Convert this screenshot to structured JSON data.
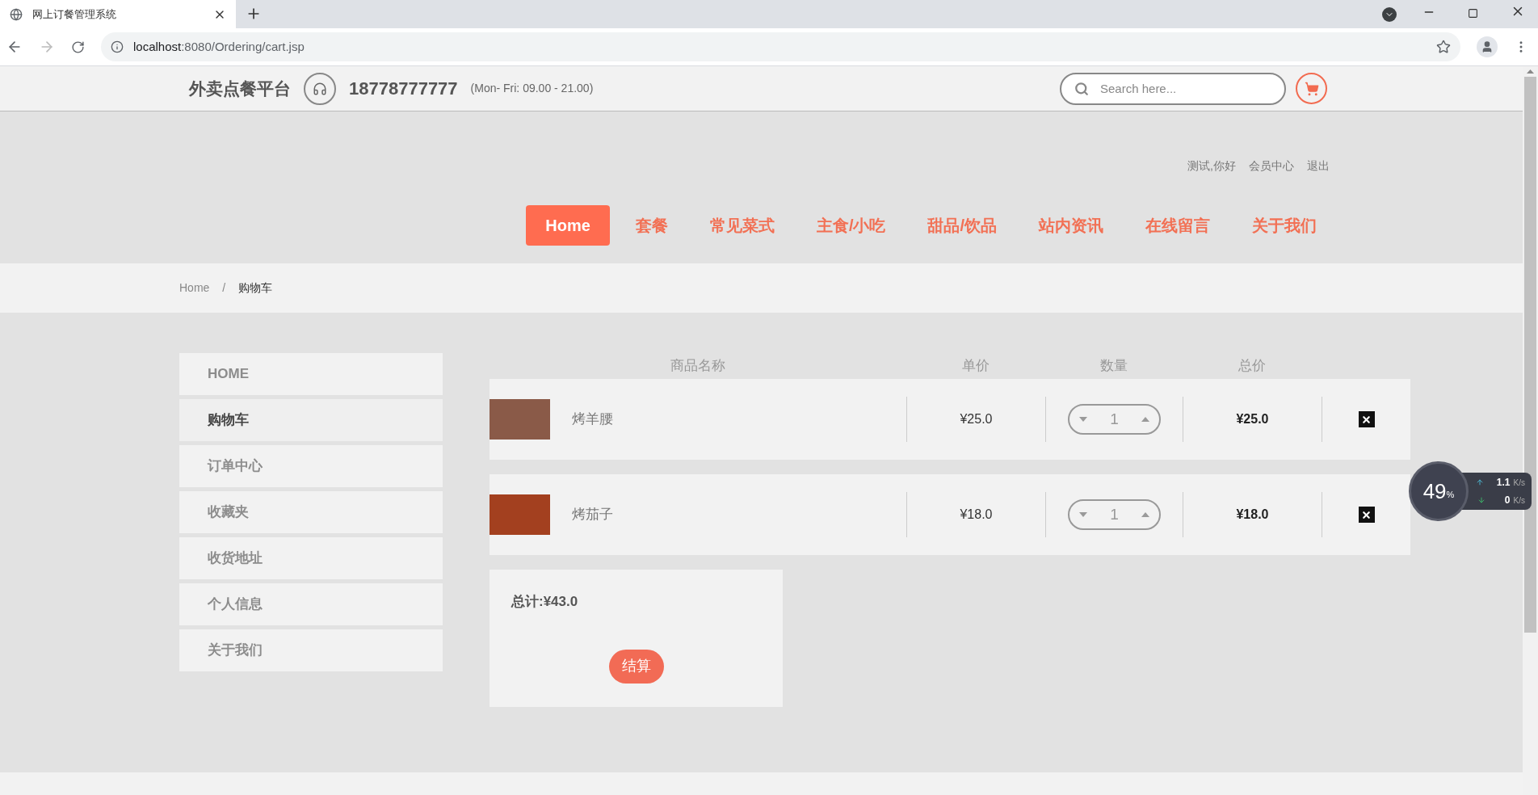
{
  "browser": {
    "tab_title": "网上订餐管理系统",
    "url_host": "localhost",
    "url_path": ":8080/Ordering/cart.jsp"
  },
  "header": {
    "logo": "外卖点餐平台",
    "phone": "18778777777",
    "hours": "(Mon- Fri: 09.00 - 21.00)",
    "search": {
      "placeholder": "Search here..."
    }
  },
  "user_links": [
    "测试,你好",
    "会员中心",
    "退出"
  ],
  "nav": [
    {
      "label": "Home",
      "selected": true
    },
    {
      "label": "套餐",
      "selected": false
    },
    {
      "label": "常见菜式",
      "selected": false
    },
    {
      "label": "主食/小吃",
      "selected": false
    },
    {
      "label": "甜品/饮品",
      "selected": false
    },
    {
      "label": "站内资讯",
      "selected": false
    },
    {
      "label": "在线留言",
      "selected": false
    },
    {
      "label": "关于我们",
      "selected": false
    }
  ],
  "breadcrumb": {
    "items": [
      "Home",
      "购物车"
    ],
    "separator": "/"
  },
  "sidebar": [
    {
      "label": "HOME",
      "selected": false
    },
    {
      "label": "购物车",
      "selected": true
    },
    {
      "label": "订单中心",
      "selected": false
    },
    {
      "label": "收藏夹",
      "selected": false
    },
    {
      "label": "收货地址",
      "selected": false
    },
    {
      "label": "个人信息",
      "selected": false
    },
    {
      "label": "关于我们",
      "selected": false
    }
  ],
  "cart": {
    "columns": [
      "商品名称",
      "单价",
      "数量",
      "总价"
    ],
    "rows": [
      {
        "name": "烤羊腰",
        "unit_price": "¥25.0",
        "quantity": "1",
        "total": "¥25.0"
      },
      {
        "name": "烤茄子",
        "unit_price": "¥18.0",
        "quantity": "1",
        "total": "¥18.0"
      }
    ],
    "summary": {
      "total": "总计:¥43.0",
      "checkout": "结算"
    }
  },
  "speed_widget": {
    "percent": "49",
    "percent_sign": "%",
    "upload": "1.1",
    "upload_unit": "K/s",
    "download": "0",
    "download_unit": "K/s"
  }
}
